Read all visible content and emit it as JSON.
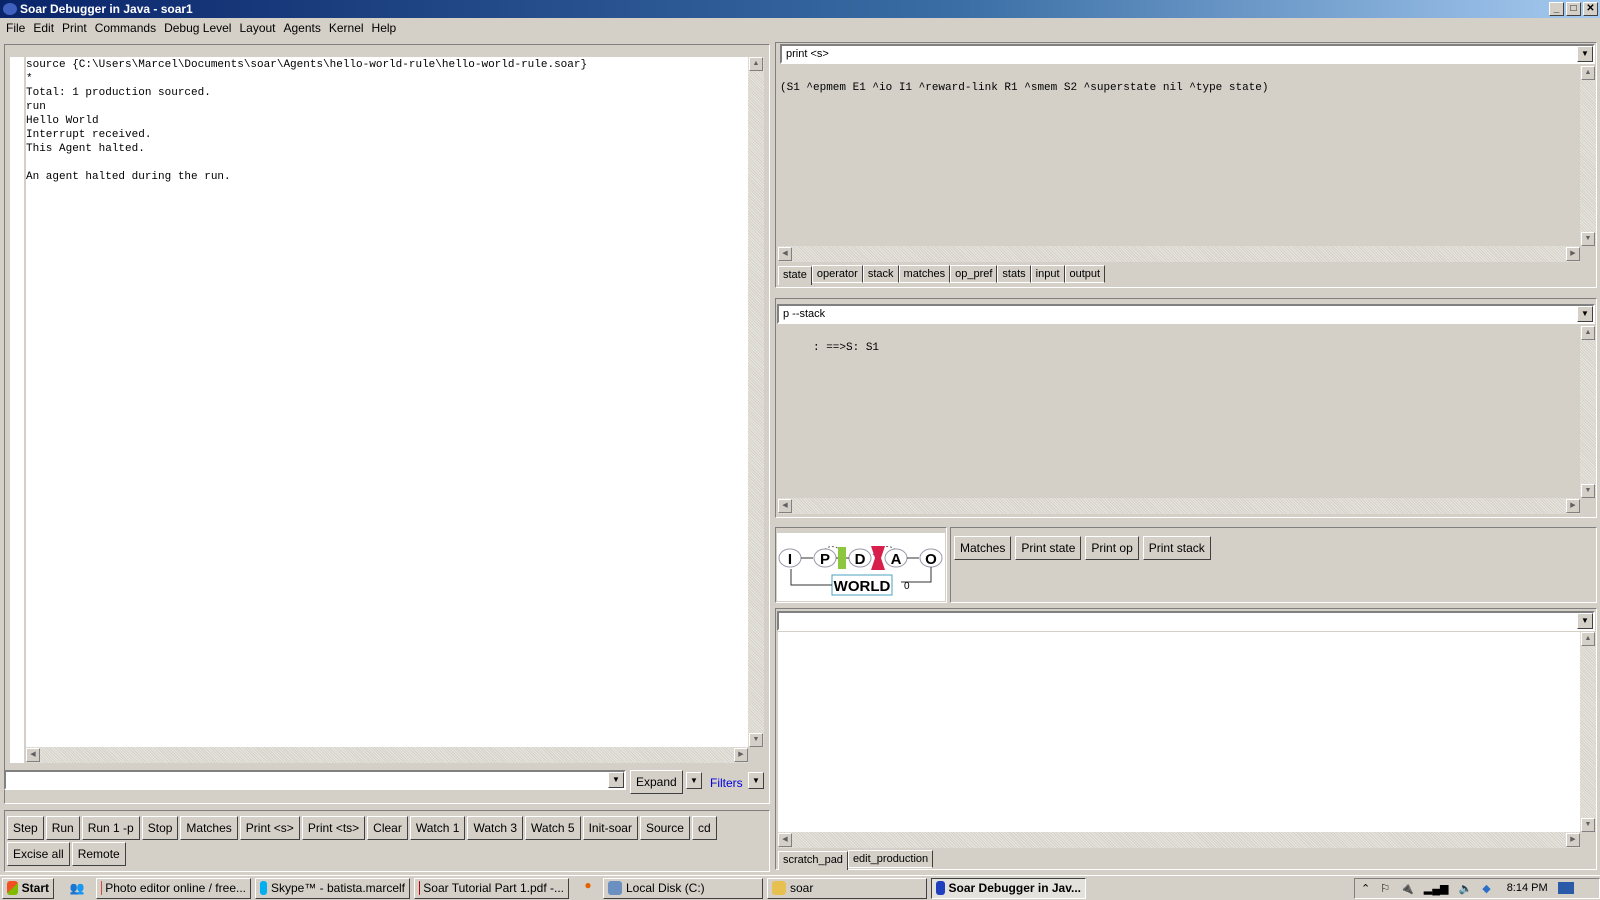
{
  "window": {
    "title": "Soar Debugger in Java - soar1"
  },
  "menu": [
    "File",
    "Edit",
    "Print",
    "Commands",
    "Debug Level",
    "Layout",
    "Agents",
    "Kernel",
    "Help"
  ],
  "main": {
    "lines": [
      "source {C:\\Users\\Marcel\\Documents\\soar\\Agents\\hello-world-rule\\hello-world-rule.soar}",
      "*",
      "Total: 1 production sourced.",
      "run",
      "Hello World",
      "Interrupt received.",
      "This Agent halted.",
      "",
      "An agent halted during the run."
    ],
    "command_value": "",
    "expand_label": "Expand",
    "filters_label": "Filters"
  },
  "buttons": [
    "Step",
    "Run",
    "Run 1 -p",
    "Stop",
    "Matches",
    "Print <s>",
    "Print <ts>",
    "Clear",
    "Watch 1",
    "Watch 3",
    "Watch 5",
    "Init-soar",
    "Source",
    "cd",
    "Excise all",
    "Remote"
  ],
  "state_pane": {
    "command": "print <s>",
    "output": "(S1 ^epmem E1 ^io I1 ^reward-link R1 ^smem S2 ^superstate nil ^type state)",
    "tabs": [
      "state",
      "operator",
      "stack",
      "matches",
      "op_pref",
      "stats",
      "input",
      "output"
    ],
    "active_tab": "state"
  },
  "stack_pane": {
    "command": "p --stack",
    "output": "     : ==>S: S1"
  },
  "logo": {
    "letters": [
      "I",
      "P",
      "D",
      "A",
      "O"
    ],
    "world": "WORLD",
    "counter": "0"
  },
  "quick_buttons": [
    "Matches",
    "Print state",
    "Print op",
    "Print stack"
  ],
  "scratch_pane": {
    "command": "",
    "tabs": [
      "scratch_pad",
      "edit_production"
    ],
    "active_tab": "scratch_pad"
  },
  "taskbar": {
    "start": "Start",
    "items": [
      {
        "label": "Photo editor online / free...",
        "color": "#db4437"
      },
      {
        "label": "Skype™ - batista.marcelf",
        "color": "#00aff0"
      },
      {
        "label": "Soar Tutorial Part 1.pdf -...",
        "color": "#c00000"
      },
      {
        "label": "Local Disk (C:)",
        "color": "#6a8fc0"
      },
      {
        "label": "soar",
        "color": "#e8c050"
      },
      {
        "label": "Soar Debugger in Jav...",
        "color": "#2040c0"
      }
    ],
    "clock": "8:14 PM"
  }
}
